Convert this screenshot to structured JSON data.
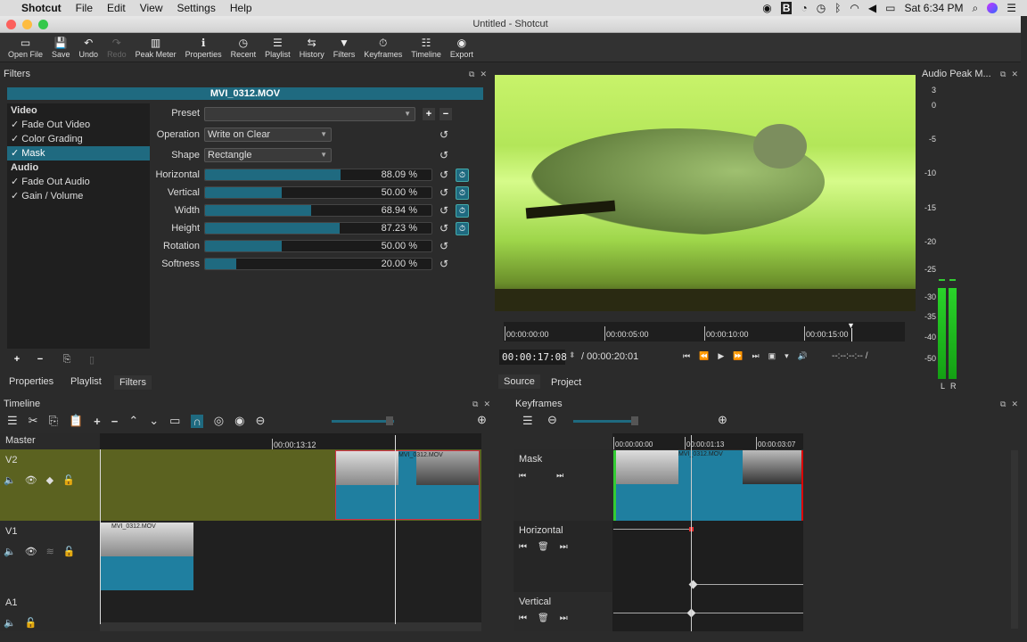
{
  "menubar": {
    "apple": "",
    "app": "Shotcut",
    "items": [
      "File",
      "Edit",
      "View",
      "Settings",
      "Help"
    ],
    "clock": "Sat 6:34 PM"
  },
  "window": {
    "title": "Untitled - Shotcut"
  },
  "toolbar": [
    {
      "label": "Open File",
      "icon": "▭"
    },
    {
      "label": "Save",
      "icon": "💾"
    },
    {
      "label": "Undo",
      "icon": "↶"
    },
    {
      "label": "Redo",
      "icon": "↷",
      "disabled": true
    },
    {
      "label": "Peak Meter",
      "icon": "▥"
    },
    {
      "label": "Properties",
      "icon": "ℹ"
    },
    {
      "label": "Recent",
      "icon": "◷"
    },
    {
      "label": "Playlist",
      "icon": "☰"
    },
    {
      "label": "History",
      "icon": "⇆"
    },
    {
      "label": "Filters",
      "icon": "▼"
    },
    {
      "label": "Keyframes",
      "icon": "⏱"
    },
    {
      "label": "Timeline",
      "icon": "☷"
    },
    {
      "label": "Export",
      "icon": "◉"
    }
  ],
  "filters": {
    "dock_title": "Filters",
    "clip_name": "MVI_0312.MOV",
    "video_header": "Video",
    "audio_header": "Audio",
    "video_filters": [
      "✓  Fade Out Video",
      "✓  Color Grading",
      "✓  Mask"
    ],
    "audio_filters": [
      "✓  Fade Out Audio",
      "✓  Gain / Volume"
    ],
    "selected": "Mask",
    "preset_label": "Preset",
    "preset_value": "",
    "operation_label": "Operation",
    "operation_value": "Write on Clear",
    "shape_label": "Shape",
    "shape_value": "Rectangle",
    "params": [
      {
        "label": "Horizontal",
        "value": "88.09 %",
        "fraction": 0.8809,
        "keyframe": true
      },
      {
        "label": "Vertical",
        "value": "50.00 %",
        "fraction": 0.5,
        "keyframe": true
      },
      {
        "label": "Width",
        "value": "68.94 %",
        "fraction": 0.6894,
        "keyframe": true
      },
      {
        "label": "Height",
        "value": "87.23 %",
        "fraction": 0.8723,
        "keyframe": true
      },
      {
        "label": "Rotation",
        "value": "50.00 %",
        "fraction": 0.5,
        "keyframe": false
      },
      {
        "label": "Softness",
        "value": "20.00 %",
        "fraction": 0.2,
        "keyframe": false
      }
    ],
    "tabs": [
      "Properties",
      "Playlist",
      "Filters"
    ],
    "active_tab": "Filters"
  },
  "player": {
    "ruler": [
      "00:00:00:00",
      "00:00:05:00",
      "00:00:10:00",
      "00:00:15:00"
    ],
    "position": "00:00:17:08",
    "duration": "/ 00:00:20:01",
    "in_out": "--:--:--:-- /",
    "tabs": [
      "Source",
      "Project"
    ],
    "active_tab": "Source"
  },
  "audio_meter": {
    "title": "Audio Peak M...",
    "scale": [
      "3",
      "0",
      "-5",
      "-10",
      "-15",
      "-20",
      "-25",
      "-30",
      "-35",
      "-40",
      "-50"
    ],
    "channels": [
      "L",
      "R"
    ],
    "level_db": -28,
    "peak_db": -26
  },
  "timeline": {
    "title": "Timeline",
    "ruler_label": "00:00:13:12",
    "tracks": [
      {
        "name": "V2"
      },
      {
        "name": "V1"
      },
      {
        "name": "A1"
      }
    ],
    "master": "Master",
    "clip_name": "MVI_0312.MOV"
  },
  "keyframes": {
    "title": "Keyframes",
    "ruler": [
      "00:00:00:00",
      "00:00:01:13",
      "00:00:03:07"
    ],
    "tracks": [
      "Mask",
      "Horizontal",
      "Vertical"
    ],
    "clip_name": "MVI_0312.MOV"
  }
}
